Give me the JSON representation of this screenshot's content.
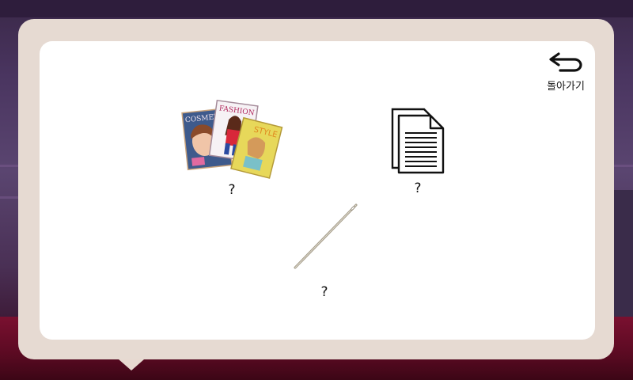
{
  "back_button": {
    "label": "돌아가기",
    "icon": "return-arrow-icon"
  },
  "items": [
    {
      "name": "magazines",
      "icon": "magazines-icon",
      "label": "?"
    },
    {
      "name": "document",
      "icon": "document-icon",
      "label": "?"
    },
    {
      "name": "needle",
      "icon": "needle-icon",
      "label": "?"
    }
  ],
  "magazine_covers": {
    "left": "COSMET",
    "middle": "FASHION",
    "right": "STYLE"
  },
  "colors": {
    "frame": "#e6dad2",
    "panel": "#ffffff",
    "scene_floor": "#5a0a22"
  }
}
